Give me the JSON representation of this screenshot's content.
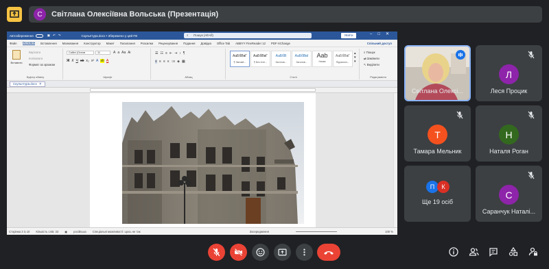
{
  "banner": {
    "avatar_letter": "С",
    "title": "Світлана Олексіївна Вольська (Презентація)"
  },
  "word": {
    "autosave_label": "Автозбереження",
    "doc_title": "Скульптура.docx • Збережено у цей ПК",
    "search_placeholder": "Пошук (Alt+Й)",
    "user_button": "Увійти",
    "tabs": [
      "Файл",
      "Основне",
      "Вставлення",
      "Малювання",
      "Конструктор",
      "Макет",
      "Посилання",
      "Розсилки",
      "Рецензування",
      "Подання",
      "Довідка",
      "Office Tab",
      "ABBYY FineReader 12",
      "PDF-XChange"
    ],
    "share_label": "Спільний доступ",
    "clipboard": {
      "paste": "Вставити",
      "cut": "Вирізати",
      "copy": "Копіювати",
      "format": "Формат за зразком",
      "label": "Буфер обміну"
    },
    "font": {
      "name": "Calibri (Основ",
      "size": "11",
      "label": "Шрифт"
    },
    "paragraph_label": "Абзац",
    "styles": [
      {
        "sample": "АаБбВвГ",
        "name": "¶ Звичай..."
      },
      {
        "sample": "АаБбВвГ",
        "name": "¶ Без інте..."
      },
      {
        "sample": "АаБбВ",
        "name": "Заголов..."
      },
      {
        "sample": "АаБбВвІ",
        "name": "Заголов..."
      },
      {
        "sample": "Ааb",
        "name": "Назва"
      },
      {
        "sample": "АаБбВвГ",
        "name": "Підзаголо..."
      }
    ],
    "styles_label": "Стилі",
    "editing": {
      "find": "Пошук",
      "replace": "Замінити",
      "select": "Виділити",
      "label": "Редагування"
    },
    "doc_tab": "Скульптура.docx",
    "status": {
      "page": "Сторінка 3 із 10",
      "words": "Кількість слів: 33",
      "language": "російська",
      "accessibility": "Спеціальні можливості: щось не так",
      "focus": "Зосередження",
      "zoom": "100 %"
    }
  },
  "participants": [
    {
      "name": "Світлана Олексі...",
      "kind": "video",
      "muted": false
    },
    {
      "name": "Леся Процик",
      "letter": "Л",
      "color": "#8e24aa",
      "muted": true
    },
    {
      "name": "Тамара Мельник",
      "letter": "Т",
      "color": "#f4511e",
      "muted": true
    },
    {
      "name": "Наталя Роган",
      "letter": "Н",
      "color": "#33691e",
      "muted": true
    },
    {
      "name": "Ще 19 осіб",
      "letters": [
        "П",
        "К"
      ],
      "colors": [
        "#1a73e8",
        "#d93025"
      ]
    },
    {
      "name": "Саранчук Наталі...",
      "letter": "С",
      "color": "#8e24aa",
      "muted": true
    }
  ],
  "controls": [
    "mic-off",
    "camera-off",
    "emoji",
    "present",
    "more",
    "leave"
  ],
  "right_controls": [
    "info",
    "people",
    "chat",
    "activities",
    "host-controls"
  ],
  "colors": {
    "red": "#ea4335",
    "bg": "#202124",
    "tile": "#3c4043",
    "accent": "#8ab4f8"
  }
}
